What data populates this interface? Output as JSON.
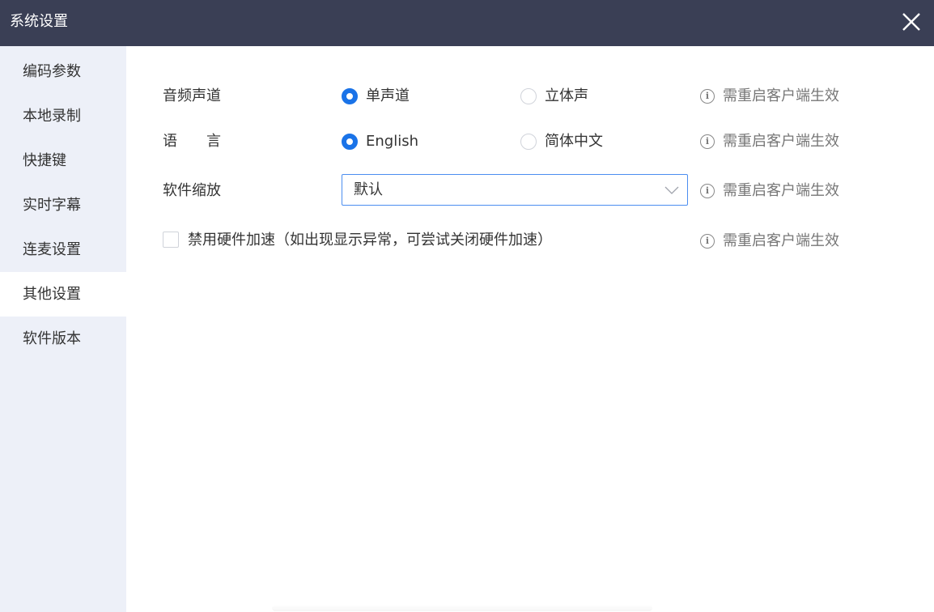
{
  "window": {
    "title": "系统设置",
    "close_icon": "close-icon"
  },
  "sidebar": {
    "items": [
      {
        "label": "编码参数",
        "active": false
      },
      {
        "label": "本地录制",
        "active": false
      },
      {
        "label": "快捷键",
        "active": false
      },
      {
        "label": "实时字幕",
        "active": false
      },
      {
        "label": "连麦设置",
        "active": false
      },
      {
        "label": "其他设置",
        "active": true
      },
      {
        "label": "软件版本",
        "active": false
      }
    ]
  },
  "settings": {
    "audio_channel": {
      "label": "音频声道",
      "options": [
        "单声道",
        "立体声"
      ],
      "selected": "单声道",
      "hint": "需重启客户端生效"
    },
    "language": {
      "label": "语　　言",
      "options": [
        "English",
        "简体中文"
      ],
      "selected": "English",
      "hint": "需重启客户端生效"
    },
    "scaling": {
      "label": "软件缩放",
      "value": "默认",
      "hint": "需重启客户端生效"
    },
    "hardware_accel": {
      "label": "禁用硬件加速（如出现显示异常，可尝试关闭硬件加速）",
      "checked": false,
      "hint": "需重启客户端生效"
    }
  },
  "colors": {
    "titlebar": "#3a3f55",
    "sidebar_bg": "#edf0f8",
    "accent": "#1a73e8"
  }
}
